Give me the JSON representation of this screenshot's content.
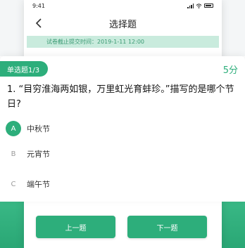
{
  "status_bar": {
    "time": "9:41"
  },
  "nav": {
    "title": "选择题",
    "back_icon": "chevron-left-icon"
  },
  "deadline": {
    "text": "试卷截止提交时间：2019-1-11 12:00"
  },
  "question": {
    "badge": "单选题1/3",
    "score": "5分",
    "text": "1. “目穷淮海两如银，万里虹光育蚌珍。”描写的是哪个节日?"
  },
  "options": [
    {
      "letter": "A",
      "label": "中秋节",
      "selected": true
    },
    {
      "letter": "B",
      "label": "元宵节",
      "selected": false
    },
    {
      "letter": "C",
      "label": "端午节",
      "selected": false
    }
  ],
  "buttons": {
    "prev": "上一题",
    "next": "下一题"
  },
  "colors": {
    "accent": "#2dae7b",
    "deadline_bg": "#c9ebdd",
    "deadline_text": "#3a9a73"
  }
}
